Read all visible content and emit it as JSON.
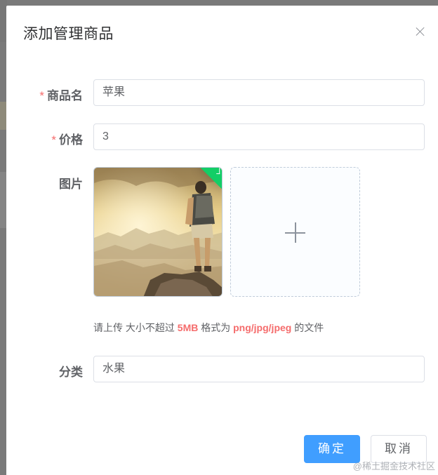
{
  "dialog": {
    "title": "添加管理商品",
    "close_icon": "close-icon"
  },
  "form": {
    "name": {
      "required_mark": "*",
      "label": "商品名",
      "value": "苹果"
    },
    "price": {
      "required_mark": "*",
      "label": "价格",
      "value": "3"
    },
    "image": {
      "label": "图片",
      "uploaded_status_icon": "check-icon",
      "add_icon": "plus-icon",
      "tip_prefix": "请上传 大小不超过",
      "tip_size": "5MB",
      "tip_middle": "格式为",
      "tip_formats": "png/jpg/jpeg",
      "tip_suffix": "的文件"
    },
    "category": {
      "label": "分类",
      "value": "水果"
    }
  },
  "footer": {
    "confirm_label": "确定",
    "cancel_label": "取消"
  },
  "watermark": "@稀土掘金技术社区",
  "colors": {
    "primary": "#409eff",
    "required": "#f56c6c",
    "success": "#13ce66"
  }
}
